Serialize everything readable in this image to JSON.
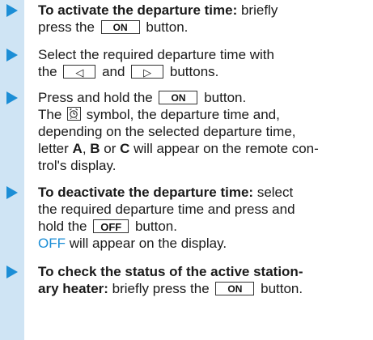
{
  "steps": [
    {
      "l1_bold": "To activate the departure time:",
      "l1_text": " briefly",
      "l2_pre": "press the ",
      "l2_key": "ON",
      "l2_post": " button."
    },
    {
      "l1": "Select the required departure time with",
      "l2_pre": "the ",
      "l2_key1": "◁",
      "l2_mid": " and ",
      "l2_key2": "▷",
      "l2_post": " buttons."
    },
    {
      "l1_pre": "Press and hold the ",
      "l1_key": "ON",
      "l1_post": " button.",
      "l2_pre": "The ",
      "l2_post": " symbol, the departure time and,",
      "l3": "depending on the selected departure time,",
      "l4_pre": "letter ",
      "letter_a": "A",
      "sep1": ", ",
      "letter_b": "B",
      "sep2": " or ",
      "letter_c": "C",
      "l4_post": " will appear on the remote con-",
      "l5": "trol's display."
    },
    {
      "l1_bold": "To deactivate the departure time:",
      "l1_text": " select",
      "l2": "the required departure time and press and",
      "l3_pre": "hold the ",
      "l3_key": "OFF",
      "l3_post": " button.",
      "l4_blue": "OFF",
      "l4_post": " will appear on the display."
    },
    {
      "l1_bold": "To check the status of the active station-",
      "l2_bold": "ary heater:",
      "l2_pre": " briefly press the ",
      "l2_key": "ON",
      "l2_post": " button."
    }
  ],
  "colors": {
    "accent": "#1c8ed6",
    "rail": "#cfe4f4"
  },
  "icons": [
    "triangle-bullet-icon",
    "clock-timer-icon"
  ]
}
